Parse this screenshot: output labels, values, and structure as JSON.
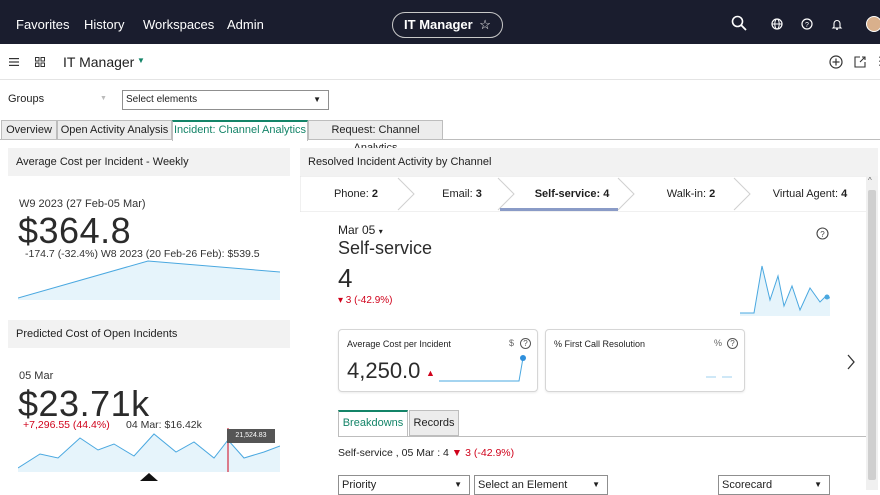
{
  "topbar": {
    "nav": [
      "Favorites",
      "History",
      "Workspaces",
      "Admin"
    ],
    "app_name": "IT Manager",
    "star": "☆"
  },
  "dashboard": {
    "title": "IT Manager"
  },
  "filters": {
    "groups_label": "Groups",
    "select_placeholder": "Select elements"
  },
  "tabs": [
    {
      "label": "Overview"
    },
    {
      "label": "Open Activity Analysis"
    },
    {
      "label": "Incident: Channel Analytics"
    },
    {
      "label": "Request: Channel Analytics"
    }
  ],
  "left": {
    "weekly": {
      "title": "Average Cost per Incident - Weekly",
      "period": "W9 2023 (27 Feb-05 Mar)",
      "value": "$364.8",
      "change": "-174.7 (-32.4%) W8 2023 (20 Feb-26 Feb): $539.5"
    },
    "predicted": {
      "title": "Predicted Cost of Open Incidents",
      "period": "05 Mar",
      "value": "$23.71k",
      "change": "+7,296.55 (44.4%)",
      "compare": "04 Mar: $16.42k",
      "tooltip": "21,524.83"
    }
  },
  "right": {
    "title": "Resolved Incident Activity by Channel",
    "channels": [
      {
        "name": "Phone:",
        "count": "2"
      },
      {
        "name": "Email:",
        "count": "3"
      },
      {
        "name": "Self-service:",
        "count": "4"
      },
      {
        "name": "Walk-in:",
        "count": "2"
      },
      {
        "name": "Virtual Agent:",
        "count": "4"
      }
    ],
    "date": "Mar 05",
    "channel_title": "Self-service",
    "count": "4",
    "count_change": "▾ 3 (-42.9%)",
    "avg_cost": {
      "title": "Average Cost per Incident",
      "unit": "$",
      "value": "4,250.0"
    },
    "fcr": {
      "title": "% First Call Resolution",
      "unit": "%"
    },
    "subtabs": [
      "Breakdowns",
      "Records"
    ],
    "summary_prefix": "Self-service , 05 Mar : 4",
    "summary_change": "▼ 3 (-42.9%)",
    "dropdowns": [
      "Priority",
      "Select an Element",
      "Scorecard"
    ]
  },
  "colors": {
    "accent": "#138468",
    "topbar": "#1a1d2e",
    "spark": "#4aa8e0",
    "down": "#d0021b"
  }
}
